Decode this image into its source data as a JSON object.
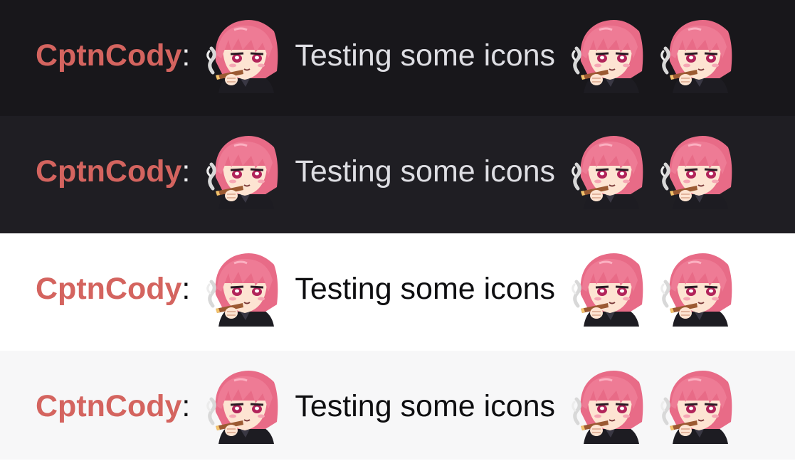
{
  "messages": [
    {
      "theme": "dark-1",
      "username": "CptnCody",
      "separator": ":",
      "text": "Testing some icons",
      "emote": "anime-girl-cigar-emote"
    },
    {
      "theme": "dark-2",
      "username": "CptnCody",
      "separator": ":",
      "text": "Testing some icons",
      "emote": "anime-girl-cigar-emote"
    },
    {
      "theme": "light-1",
      "username": "CptnCody",
      "separator": ":",
      "text": "Testing some icons",
      "emote": "anime-girl-cigar-emote"
    },
    {
      "theme": "light-2",
      "username": "CptnCody",
      "separator": ":",
      "text": "Testing some icons",
      "emote": "anime-girl-cigar-emote"
    }
  ],
  "colors": {
    "username": "#d4645f",
    "dark_bg_1": "#18171b",
    "dark_bg_2": "#1f1e23",
    "light_bg_1": "#ffffff",
    "light_bg_2": "#f7f7f8",
    "hair": "#ee7b95",
    "hoodie": "#1d1c22"
  }
}
